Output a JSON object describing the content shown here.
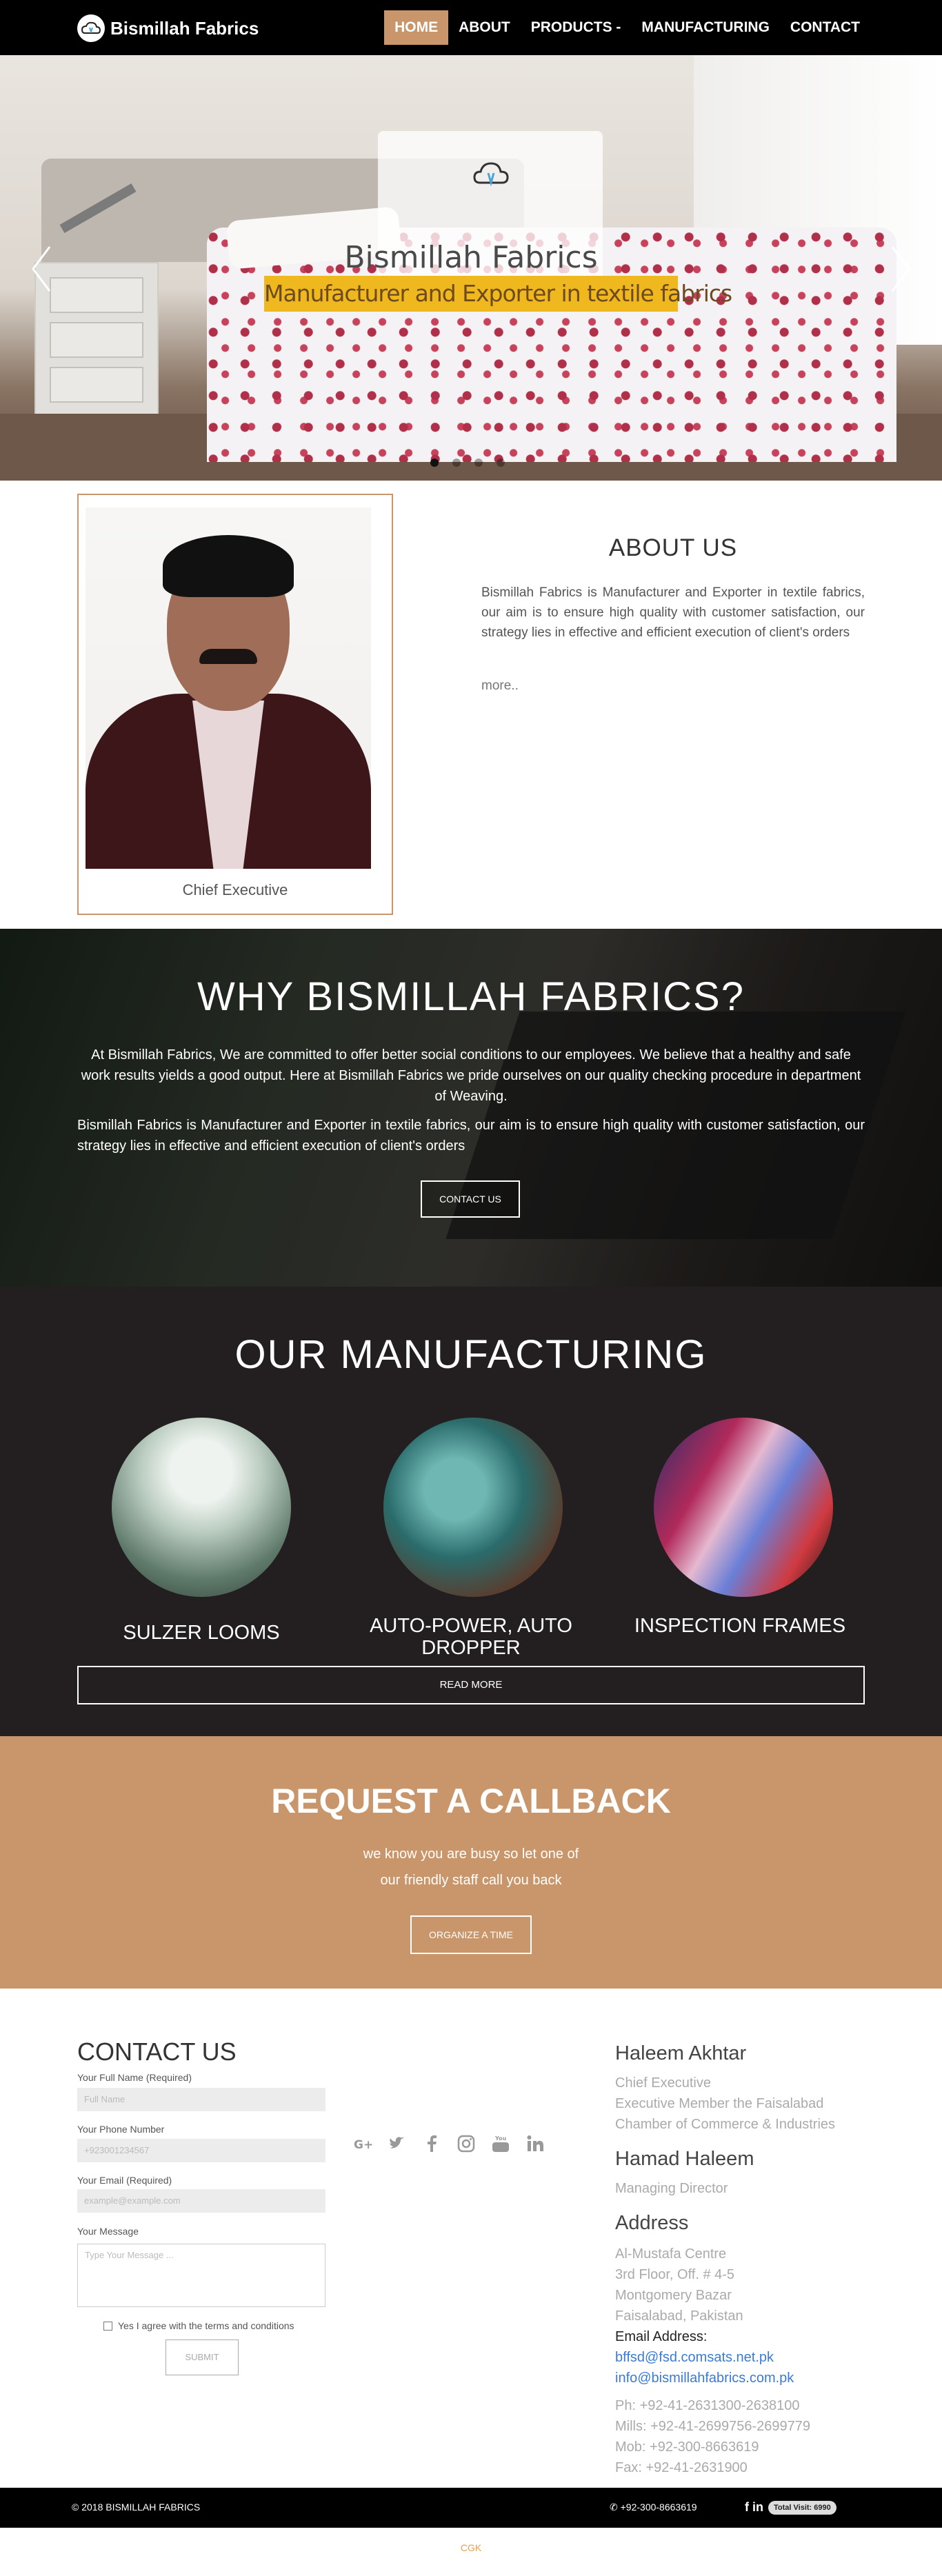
{
  "nav": {
    "brand": "Bismillah Fabrics",
    "items": [
      "HOME",
      "ABOUT",
      "PRODUCTS -",
      "MANUFACTURING",
      "CONTACT"
    ]
  },
  "hero": {
    "title": "Bismillah Fabrics",
    "subtitle": "Manufacturer and Exporter in textile fabrics",
    "accent": "#f0b81f"
  },
  "about": {
    "caption": "Chief Executive",
    "title": "ABOUT US",
    "text": "Bismillah Fabrics is Manufacturer and Exporter in textile fabrics, our aim is to ensure high quality with customer satisfaction, our strategy lies in effective and efficient execution of client's orders",
    "more": "more.."
  },
  "why": {
    "title": "WHY BISMILLAH FABRICS?",
    "p1": "At Bismillah Fabrics, We are committed to offer better social conditions to our employees. We believe that a healthy and safe work results yields a good output. Here at Bismillah Fabrics we pride ourselves on our quality checking procedure in department of Weaving.",
    "p2": "Bismillah Fabrics is Manufacturer and Exporter in textile fabrics, our aim is to ensure high quality with customer satisfaction, our strategy lies in effective and efficient execution of client's orders",
    "button": "CONTACT US"
  },
  "manufacturing": {
    "title": "OUR MANUFACTURING",
    "items": [
      "SULZER LOOMS",
      "AUTO-POWER, AUTO DROPPER",
      "INSPECTION FRAMES"
    ],
    "button": "READ MORE"
  },
  "callback": {
    "title": "REQUEST A CALLBACK",
    "line1": "we know you are busy so let one of",
    "line2": "our friendly staff call you back",
    "button": "ORGANIZE A TIME",
    "color": "#c8966a"
  },
  "contact": {
    "title": "CONTACT US",
    "fields": [
      {
        "label": "Your Full Name (Required)",
        "placeholder": "Full Name"
      },
      {
        "label": "Your Phone Number",
        "placeholder": "+923001234567"
      },
      {
        "label": "Your Email (Required)",
        "placeholder": "example@example.com"
      },
      {
        "label": "Your Message",
        "placeholder": "Type Your Message ..."
      }
    ],
    "agree": "Yes I agree with the terms and conditions",
    "submit": "SUBMIT",
    "social_icons": [
      "google-plus-icon",
      "twitter-icon",
      "facebook-icon",
      "instagram-icon",
      "youtube-icon",
      "linkedin-icon"
    ]
  },
  "info": {
    "person1": {
      "name": "Haleem Akhtar",
      "title": "Chief Executive",
      "role1": "Executive Member the Faisalabad",
      "role2": "Chamber of Commerce & Industries"
    },
    "person2": {
      "name": "Hamad Haleem",
      "title": "Managing Director"
    },
    "address_title": "Address",
    "address": [
      "Al-Mustafa Centre",
      "3rd Floor, Off. # 4-5",
      "Montgomery Bazar",
      "Faisalabad, Pakistan"
    ],
    "email_label": "Email Address:",
    "emails": [
      "bffsd@fsd.comsats.net.pk",
      "info@bismillahfabrics.com.pk"
    ],
    "phones": [
      "Ph: +92-41-2631300-2638100",
      "Mills: +92-41-2699756-2699779",
      "Mob: +92-300-8663619",
      "Fax: +92-41-2631900"
    ]
  },
  "footer": {
    "copyright": "© 2018 BISMILLAH FABRICS",
    "phone": "+92-300-8663619",
    "social": "f in",
    "visits": "Total Visit: 6990",
    "credit": "CGK"
  }
}
